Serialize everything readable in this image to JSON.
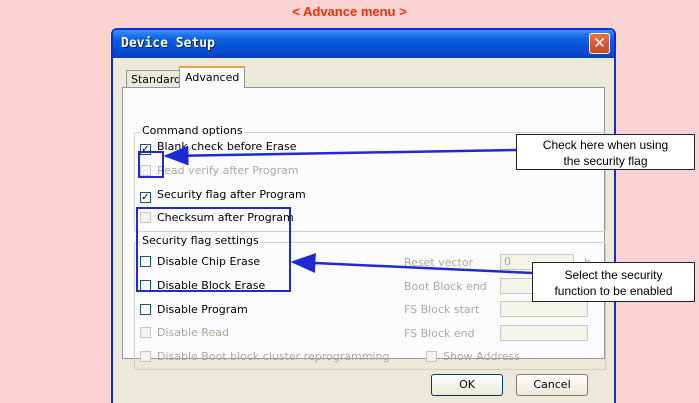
{
  "heading": "< Advance menu >",
  "dialog": {
    "title": "Device Setup",
    "close_glyph": "✕",
    "tabs": [
      {
        "label": "Standard",
        "active": false
      },
      {
        "label": "Advanced",
        "active": true
      }
    ],
    "command_options": {
      "label": "Command options",
      "items": [
        {
          "label": "Blank check before Erase",
          "checked": true,
          "enabled": true
        },
        {
          "label": "Read verify after Program",
          "checked": false,
          "enabled": false
        },
        {
          "label": "Security flag after Program",
          "checked": true,
          "enabled": true
        },
        {
          "label": "Checksum after Program",
          "checked": false,
          "enabled": true
        }
      ]
    },
    "security_flag_settings": {
      "label": "Security flag settings",
      "items": [
        {
          "label": "Disable Chip Erase",
          "checked": false,
          "enabled": true
        },
        {
          "label": "Disable Block Erase",
          "checked": false,
          "enabled": true
        },
        {
          "label": "Disable Program",
          "checked": false,
          "enabled": true
        },
        {
          "label": "Disable Read",
          "checked": false,
          "enabled": false
        },
        {
          "label": "Disable Boot block cluster reprogramming",
          "checked": false,
          "enabled": false
        }
      ],
      "fields": {
        "reset_vector": {
          "label": "Reset vector",
          "value": "0",
          "unit": "h"
        },
        "boot_block_end": {
          "label": "Boot Block end",
          "value": ""
        },
        "fs_block_start": {
          "label": "FS Block start",
          "value": ""
        },
        "fs_block_end": {
          "label": "FS Block end",
          "value": ""
        }
      },
      "show_address": {
        "label": "Show Address",
        "checked": false,
        "enabled": false
      }
    },
    "buttons": {
      "ok": "OK",
      "cancel": "Cancel"
    }
  },
  "annotations": {
    "security_flag_callout": {
      "line1": "Check here when using",
      "line2": "the security flag"
    },
    "security_function_callout": {
      "line1": "Select the security",
      "line2": "function to be enabled"
    },
    "color": "#1d2bd1"
  },
  "colors": {
    "background": "#fcd3d3",
    "heading": "#ff2d00",
    "titlebar": "#0a5fe0",
    "close_button": "#c74627"
  }
}
